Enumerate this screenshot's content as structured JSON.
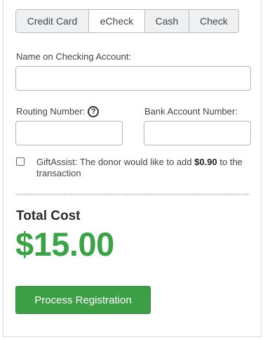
{
  "tabs": [
    {
      "label": "Credit Card"
    },
    {
      "label": "eCheck"
    },
    {
      "label": "Cash"
    },
    {
      "label": "Check"
    }
  ],
  "form": {
    "name_label": "Name on Checking Account:",
    "name_value": "",
    "routing_label": "Routing Number:",
    "routing_value": "",
    "help_glyph": "?",
    "account_label": "Bank Account Number:",
    "account_value": ""
  },
  "gift_assist": {
    "checked": false,
    "text_before": "GiftAssist: The donor would like to add ",
    "amount": "$0.90",
    "text_after": " to the transaction"
  },
  "total": {
    "label": "Total Cost",
    "value": "$15.00"
  },
  "actions": {
    "process_label": "Process Registration"
  },
  "colors": {
    "accent_green": "#3aa346",
    "button_green": "#3d9f45"
  }
}
